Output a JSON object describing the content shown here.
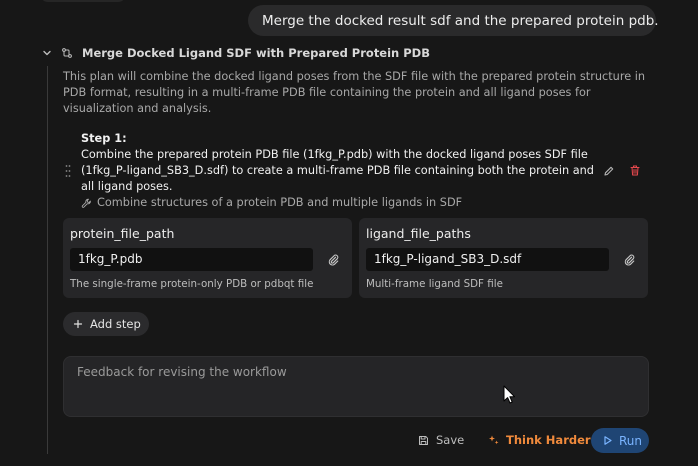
{
  "chat": {
    "user_message": "Merge the docked result sdf and the prepared protein pdb."
  },
  "plan": {
    "title": "Merge Docked Ligand SDF with Prepared Protein PDB",
    "description": "This plan will combine the docked ligand poses from the SDF file with the prepared protein structure in PDB format, resulting in a multi-frame PDB file containing the protein and all ligand poses for visualization and analysis.",
    "step": {
      "label": "Step 1:",
      "text": "Combine the prepared protein PDB file (1fkg_P.pdb) with the docked ligand poses SDF file (1fkg_P-ligand_SB3_D.sdf) to create a multi-frame PDB file containing both the protein and all ligand poses.",
      "tool": "Combine structures of a protein PDB and multiple ligands in SDF"
    },
    "params": [
      {
        "name": "protein_file_path",
        "value": "1fkg_P.pdb",
        "help": "The single-frame protein-only PDB or pdbqt file"
      },
      {
        "name": "ligand_file_paths",
        "value": "1fkg_P-ligand_SB3_D.sdf",
        "help": "Multi-frame ligand SDF file"
      }
    ],
    "add_step_label": "Add step"
  },
  "feedback": {
    "placeholder": "Feedback for revising the workflow"
  },
  "actions": {
    "save_label": "Save",
    "think_harder_label": "Think Harder",
    "run_label": "Run"
  },
  "colors": {
    "background": "#171717",
    "accent_orange": "#f08a3c",
    "run_blue": "#7ab4ff",
    "delete_red": "#e5484d"
  },
  "icons": {
    "collapse": "chevron-down-icon",
    "workflow": "workflow-icon",
    "drag": "drag-handle-icon",
    "edit": "pencil-icon",
    "delete": "trash-icon",
    "tool": "tool-icon",
    "attach": "paperclip-icon",
    "add": "plus-icon",
    "save": "save-icon",
    "think": "sparkle-icon",
    "run": "play-icon"
  }
}
